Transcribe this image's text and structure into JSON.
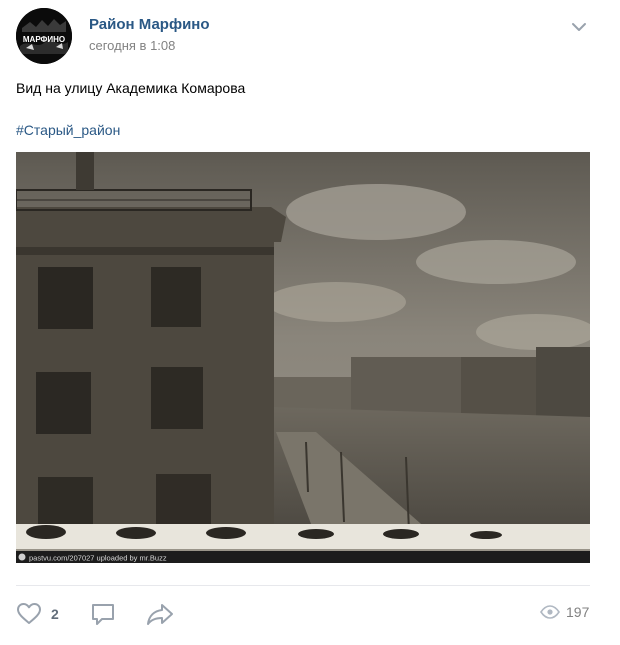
{
  "post": {
    "author": "Район Марфино",
    "date": "сегодня в 1:08",
    "text": "Вид на улицу Академика Комарова",
    "hashtag": "#Старый_район",
    "avatar_text": "МАРФИНО",
    "photo_caption": "pastvu.com/207027  uploaded by mr.Buzz"
  },
  "actions": {
    "likes": "2",
    "views": "197"
  },
  "icons": {
    "menu": "chevron-down-icon",
    "like": "heart-icon",
    "comment": "comment-icon",
    "share": "share-arrow-icon",
    "views": "eye-icon"
  },
  "colors": {
    "link": "#2a5885",
    "muted": "#828282",
    "icon": "#99a2ad"
  }
}
